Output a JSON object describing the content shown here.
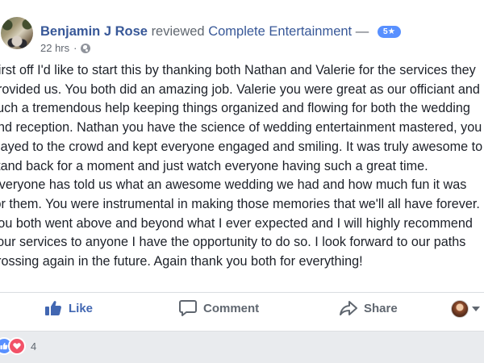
{
  "post": {
    "author": "Benjamin J Rose",
    "verb": "reviewed",
    "page_name": "Complete Entertainment",
    "dash": "—",
    "rating": "5★",
    "time": "22 hrs",
    "separator": "·",
    "privacy_icon": "globe-icon",
    "body": "First off I'd like to start this by thanking both Nathan and Valerie for the services they provided us. You both did an amazing job. Valerie you were great as our officiant and such a tremendous help keeping things organized and flowing for both the wedding and reception. Nathan you have the science of wedding entertainment mastered, you played to the crowd and kept everyone engaged and smiling. It was truly awesome to stand back for a moment and just watch everyone having such a great time. Everyone has told us what an awesome wedding we had and how much fun it was for them. You were instrumental in making those memories that we'll all have forever. You both went above and beyond what I ever expected and I will highly recommend your services to anyone I have the opportunity to do so. I look forward to our paths crossing again in the future. Again thank you both for everything!"
  },
  "actions": {
    "like_label": "Like",
    "comment_label": "Comment",
    "share_label": "Share"
  },
  "reactions": {
    "count": "4",
    "types": [
      "like",
      "love"
    ]
  },
  "colors": {
    "link": "#385898",
    "like_active": "#4267b2",
    "rating_badge": "#5890ff",
    "love": "#f25268",
    "muted": "#606770",
    "background": "#e9ebee"
  }
}
